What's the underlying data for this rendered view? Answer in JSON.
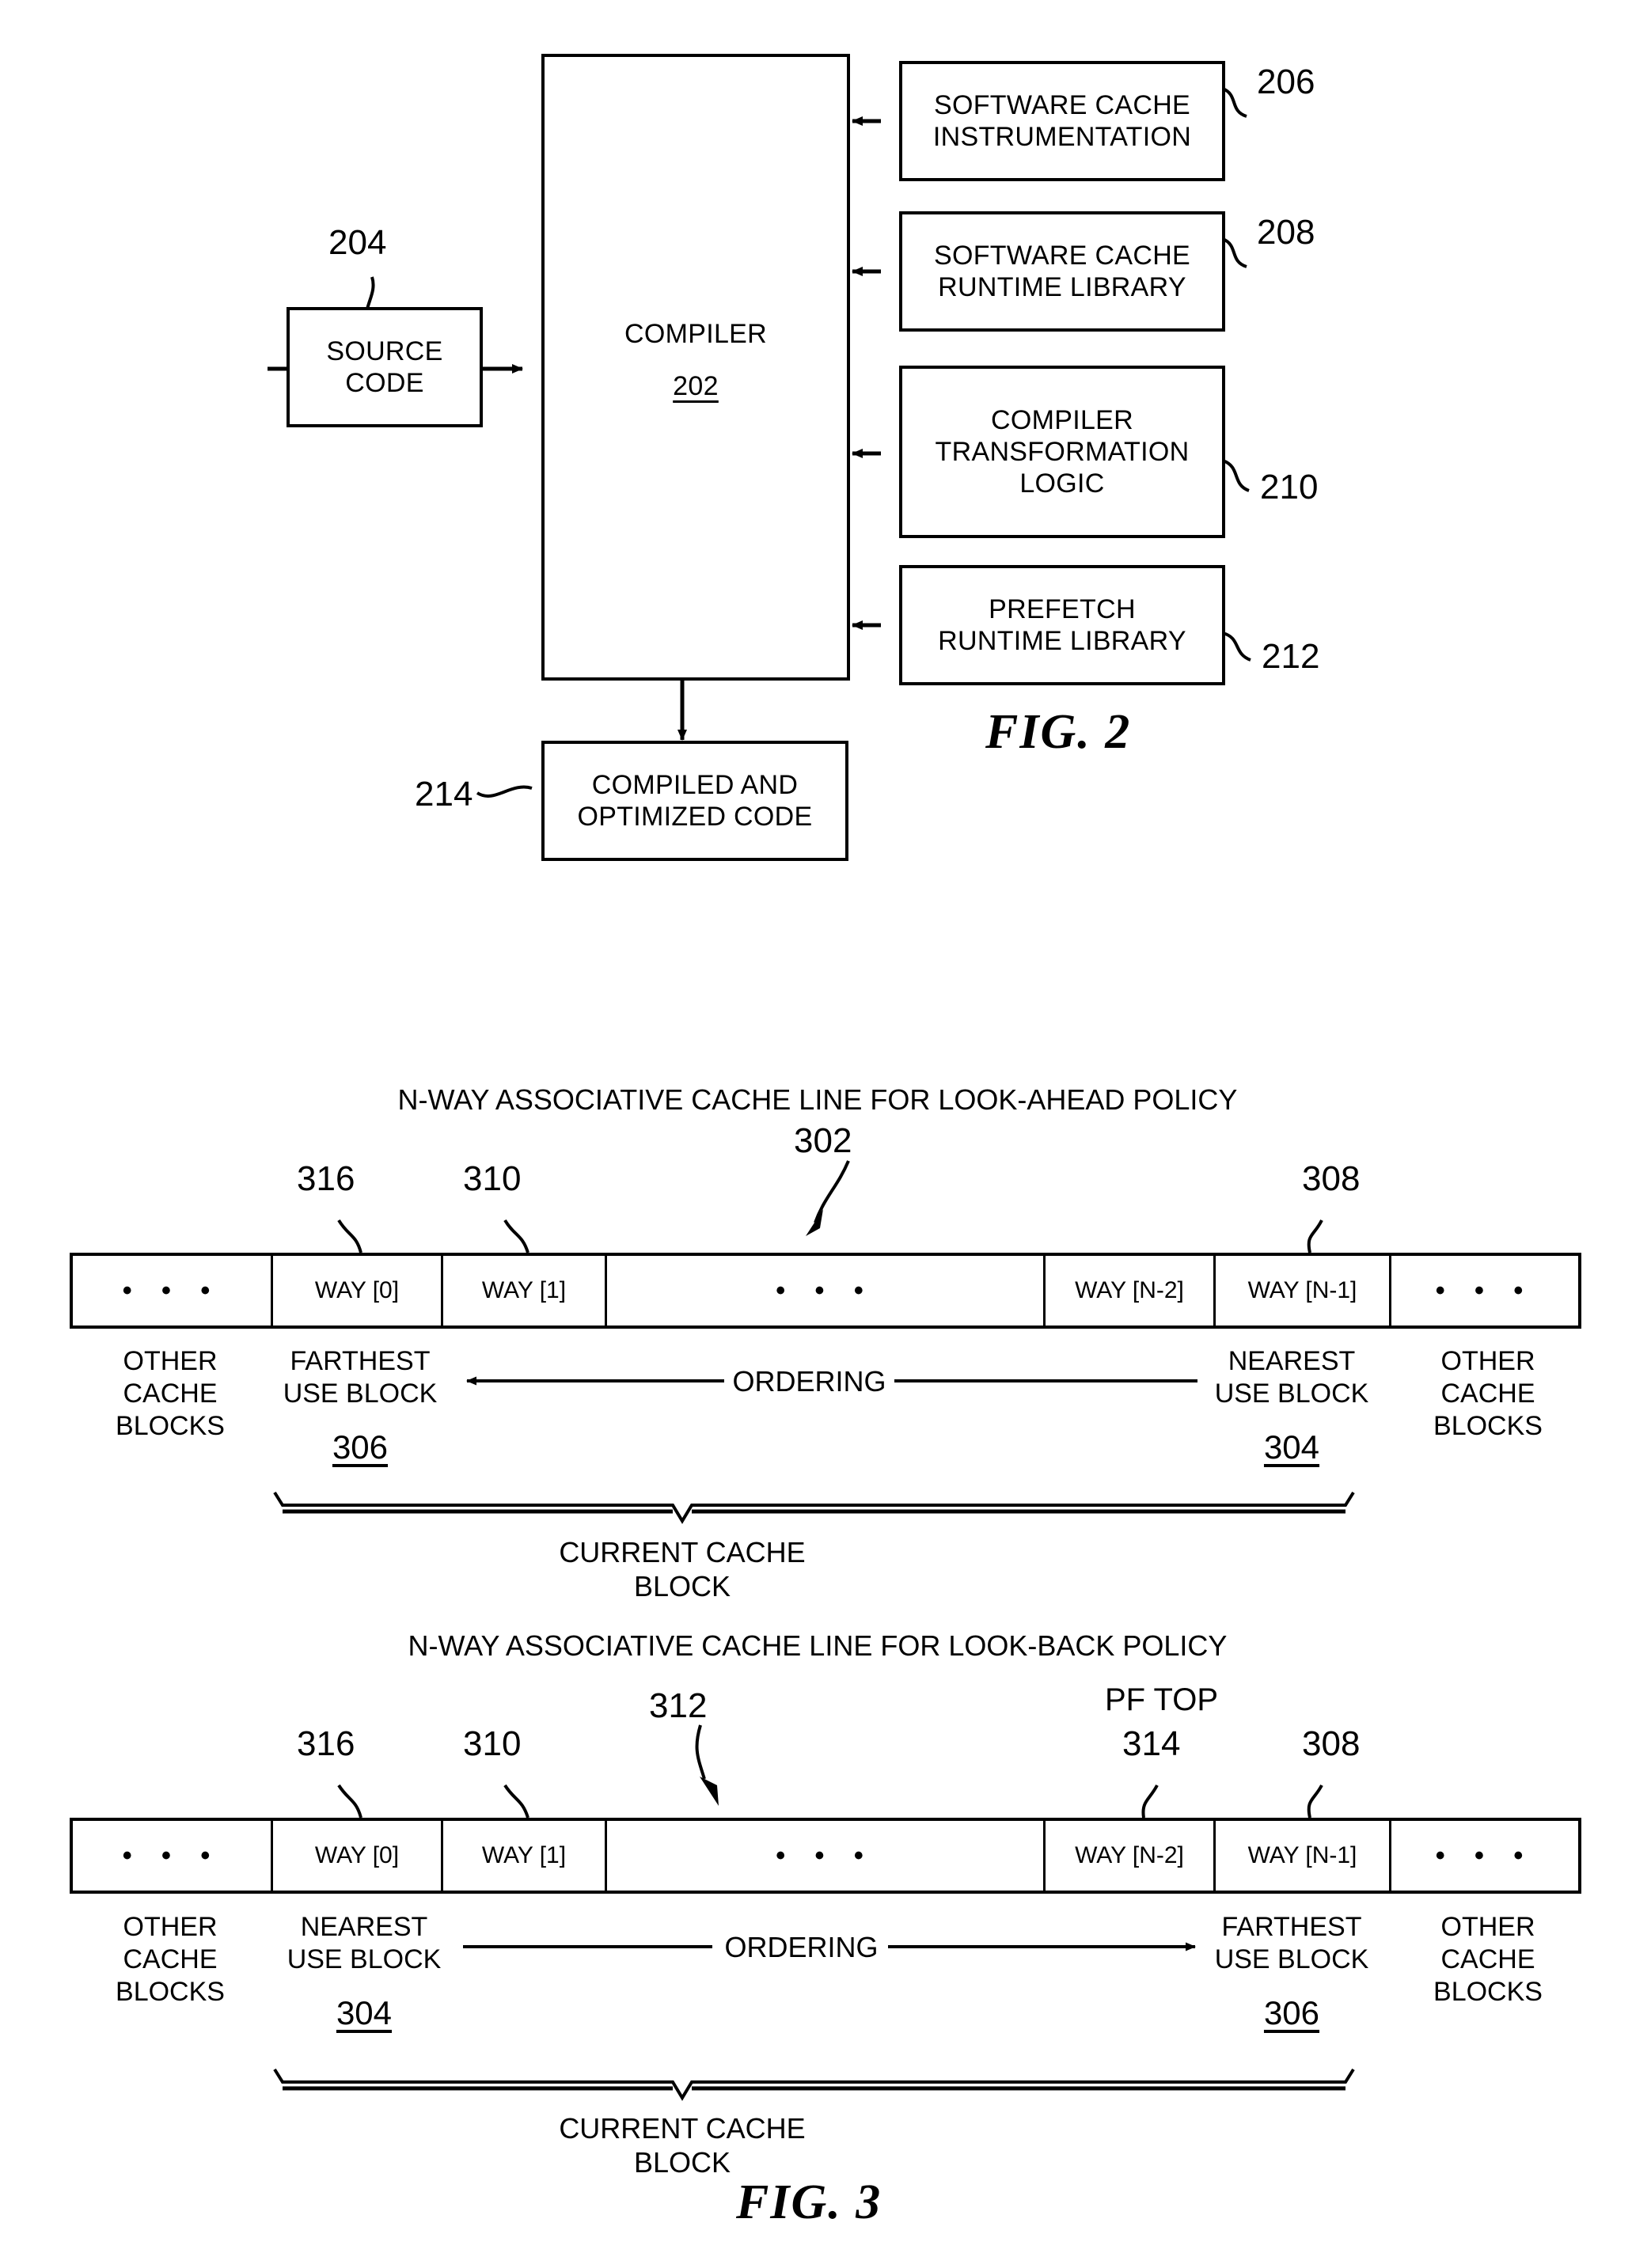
{
  "figures": [
    {
      "id": "fig2",
      "label": "FIG. 2",
      "boxes": {
        "source_code": "SOURCE\nCODE",
        "compiler_title": "COMPILER",
        "compiler_num": "202",
        "sw_cache_instrumentation": "SOFTWARE CACHE\nINSTRUMENTATION",
        "sw_cache_runtime": "SOFTWARE CACHE\nRUNTIME LIBRARY",
        "compiler_transform": "COMPILER\nTRANSFORMATION\nLOGIC",
        "prefetch_runtime": "PREFETCH\nRUNTIME LIBRARY",
        "compiled_optimized": "COMPILED AND\nOPTIMIZED CODE"
      },
      "refs": {
        "source_code": "204",
        "sw_cache_instrumentation": "206",
        "sw_cache_runtime": "208",
        "compiler_transform": "210",
        "prefetch_runtime": "212",
        "compiled_optimized": "214"
      }
    },
    {
      "id": "fig3",
      "label": "FIG. 3",
      "diagrams": [
        {
          "id": "look-ahead",
          "title": "N-WAY ASSOCIATIVE CACHE LINE FOR LOOK-AHEAD POLICY",
          "line_ref": "302",
          "cells": [
            {
              "label": "• • •",
              "kind": "ellipsis"
            },
            {
              "label": "WAY [0]",
              "kind": "way"
            },
            {
              "label": "WAY [1]",
              "kind": "way"
            },
            {
              "label": "• • •",
              "kind": "ellipsis"
            },
            {
              "label": "WAY [N-2]",
              "kind": "way"
            },
            {
              "label": "WAY [N-1]",
              "kind": "way"
            },
            {
              "label": "• • •",
              "kind": "ellipsis"
            }
          ],
          "callouts": {
            "way0": "316",
            "way1": "310",
            "wayn1": "308"
          },
          "below": {
            "left_other": "OTHER\nCACHE\nBLOCKS",
            "left_block": "FARTHEST\nUSE BLOCK",
            "left_block_num": "306",
            "ordering": "ORDERING",
            "ordering_direction": "left",
            "right_block": "NEAREST\nUSE BLOCK",
            "right_block_num": "304",
            "right_other": "OTHER\nCACHE\nBLOCKS",
            "brace_label": "CURRENT CACHE BLOCK"
          }
        },
        {
          "id": "look-back",
          "title": "N-WAY ASSOCIATIVE CACHE LINE FOR LOOK-BACK POLICY",
          "line_ref": "312",
          "cells": [
            {
              "label": "• • •",
              "kind": "ellipsis"
            },
            {
              "label": "WAY [0]",
              "kind": "way"
            },
            {
              "label": "WAY [1]",
              "kind": "way"
            },
            {
              "label": "• • •",
              "kind": "ellipsis"
            },
            {
              "label": "WAY [N-2]",
              "kind": "way"
            },
            {
              "label": "WAY [N-1]",
              "kind": "way"
            },
            {
              "label": "• • •",
              "kind": "ellipsis"
            }
          ],
          "callouts": {
            "way0": "316",
            "way1": "310",
            "wayn2_title": "PF TOP",
            "wayn2": "314",
            "wayn1": "308"
          },
          "below": {
            "left_other": "OTHER\nCACHE\nBLOCKS",
            "left_block": "NEAREST\nUSE BLOCK",
            "left_block_num": "304",
            "ordering": "ORDERING",
            "ordering_direction": "right",
            "right_block": "FARTHEST\nUSE BLOCK",
            "right_block_num": "306",
            "right_other": "OTHER\nCACHE\nBLOCKS",
            "brace_label": "CURRENT CACHE BLOCK"
          }
        }
      ]
    }
  ],
  "colors": {
    "ink": "#000000",
    "paper": "#ffffff"
  }
}
